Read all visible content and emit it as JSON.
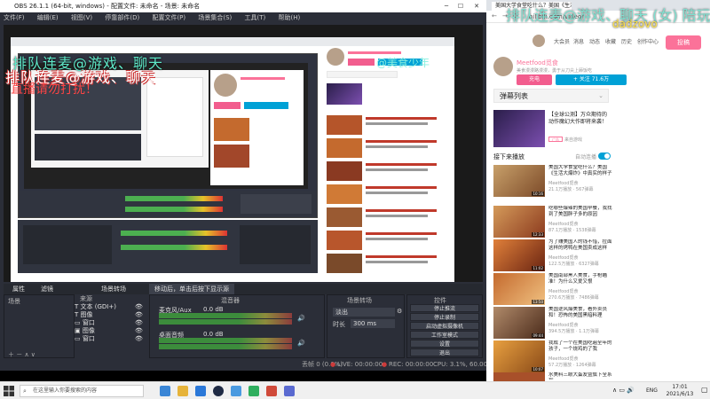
{
  "obs": {
    "title": "OBS 26.1.1 (64-bit, windows) - 配置文件: 未命名 - 场景: 未命名",
    "menu": [
      "文件(F)",
      "编辑(E)",
      "视图(V)",
      "停靠部件(D)",
      "配置文件(P)",
      "场景集合(S)",
      "工具(T)",
      "帮助(H)"
    ],
    "overlay_texts": [
      "排队连麦@游戏、聊天",
      "排队连麦@游戏、聊天",
      "直播请勿打扰！",
      "@美食少年"
    ],
    "dock_tabs": [
      "属性",
      "滤镜",
      "场景转场",
      "移动后，单击后按下显示源"
    ],
    "dock_titles": {
      "sources": "来源",
      "mixer": "混音器",
      "transitions": "场景转场",
      "controls": "控件"
    },
    "sources": [
      "文本 (GDI+)",
      "图像",
      "窗口",
      "图像",
      "窗口"
    ],
    "mixer": [
      {
        "name": "桌面音频",
        "db": "0.0 dB"
      },
      {
        "name": "麦克风/Aux",
        "db": "0.0 dB"
      }
    ],
    "transition": {
      "type": "淡出",
      "duration_label": "时长",
      "duration": "300 ms"
    },
    "controls": [
      "停止推流",
      "停止录制",
      "启动虚拟摄像机",
      "工作室模式",
      "设置",
      "退出"
    ],
    "status": {
      "dropped": "丢帧 0 (0.0%)",
      "live": "LIVE: 00:00:00",
      "rec": "REC: 00:00:00",
      "cpu": "CPU: 3.1%, 60.00 fps"
    }
  },
  "browser": {
    "tab_title": "美国大学食堂吃什么？美国《生活大爆炸》",
    "address": "bilibili.com/video/",
    "nav": [
      "大会员",
      "消息",
      "动态",
      "收藏",
      "历史",
      "创作中心"
    ],
    "upload_label": "投稿",
    "uploader": {
      "name": "Meetfood觅食",
      "desc": "美食漫漫路漫漫，勇于从刀尖上舔饭吃",
      "charge": "充电",
      "follow": "+ 关注 71.6万"
    },
    "danmaku_label": "弹幕列表",
    "ad": {
      "title": "【全球公测】万众期待的动作魔幻大作即将来袭！",
      "badge": "广告",
      "sub": "来自游戏"
    },
    "next_label": "接下来播放",
    "autoplay_label": "自动连播",
    "videos": [
      {
        "title": "美国大学食堂吃什么？美国《生活大爆炸》中真实的样子",
        "author": "Meetfood觅食",
        "stats": "21.1万播放 · 567弹幕",
        "dur": "10:16"
      },
      {
        "title": "吃哪些爆辣的美国早餐，我找到了美国胖子多的原因",
        "author": "Meetfood觅食",
        "stats": "87.1万播放 · 1538弹幕",
        "dur": "12:33"
      },
      {
        "title": "为了赚美国人的钱不惜，拉面这样的烤鸭在美国卖成这样",
        "author": "Meetfood觅食",
        "stats": "122.5万播放 · 6327弹幕",
        "dur": "11:02"
      },
      {
        "title": "美国南部黑人美食，手枪瞄准！为什么又爱又恨",
        "author": "Meetfood觅食",
        "stats": "270.6万播放 · 7486弹幕",
        "dur": "13:50"
      },
      {
        "title": "美国逆风爆美食，看外卖员和！恐怖的美国黑暗料理",
        "author": "Meetfood觅食",
        "stats": "394.5万播放 · 1.1万弹幕",
        "dur": "09:44"
      },
      {
        "title": "我成了一个在美国吃遍全年的孩子，一个烧鸡的了我",
        "author": "Meetfood觅食",
        "stats": "57.2万播放 · 1264弹幕",
        "dur": "10:07"
      },
      {
        "title": "水美料三眼大蛋友暨旗下全系列",
        "author": "",
        "stats": "",
        "dur": ""
      }
    ],
    "watermark_1": "排队连麦@游戏、聊天 (女) 陪玩+V",
    "watermark_2": "dadzovo"
  },
  "taskbar": {
    "search_placeholder": "在这里输入你要搜索的内容",
    "lang": "ENG",
    "time": "17:01",
    "date": "2021/6/13"
  },
  "colors": {
    "accent_pink": "#fb7299",
    "accent_blue": "#00a1d6",
    "obs_bg": "#2b2e38"
  }
}
